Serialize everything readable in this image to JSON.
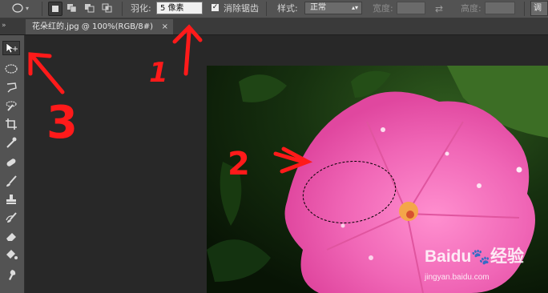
{
  "options_bar": {
    "feather_label": "羽化:",
    "feather_value": "5 像素",
    "antialias_label": "消除锯齿",
    "antialias_checked": true,
    "style_label": "样式:",
    "style_value": "正常",
    "width_label": "宽度:",
    "height_label": "高度:",
    "right_button_label": "调"
  },
  "document_tab": {
    "title": "花朵红的.jpg @ 100%(RGB/8#)",
    "close_glyph": "×"
  },
  "annotations": {
    "n1": "1",
    "n2": "2",
    "n3": "3"
  },
  "watermark": {
    "brand": "Baidu",
    "product": "经验",
    "url": "jingyan.baidu.com"
  },
  "colors": {
    "accent_annotation": "#ff1a1a",
    "flower": "#f06ab8",
    "panel": "#535353"
  }
}
